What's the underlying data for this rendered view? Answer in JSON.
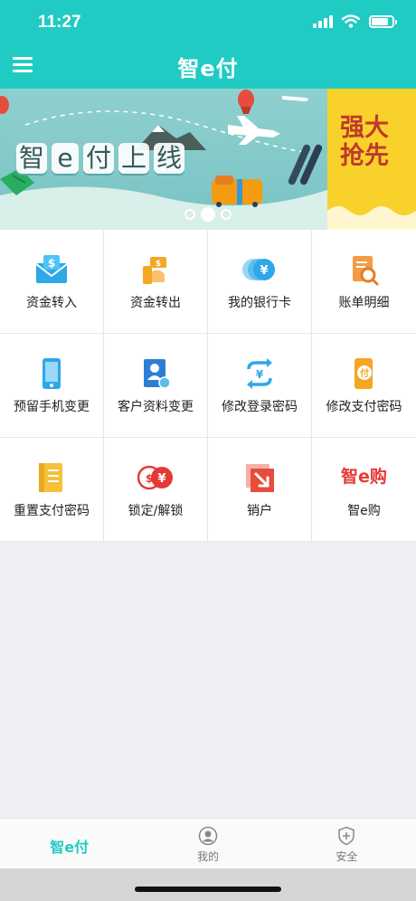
{
  "status": {
    "time": "11:27",
    "battery_level": 0.8
  },
  "header": {
    "title": "智e付",
    "menu_icon": "hamburger-menu-icon"
  },
  "banner": {
    "headline": [
      "智",
      "e",
      "付",
      "上",
      "线"
    ],
    "next_slide_text": [
      "强大",
      "抢先"
    ],
    "page_count": 3,
    "active_page": 2
  },
  "grid": [
    {
      "name": "deposit-funds",
      "label": "资金转入",
      "icon": "money-envelope-icon"
    },
    {
      "name": "withdraw-funds",
      "label": "资金转出",
      "icon": "cash-out-icon"
    },
    {
      "name": "my-bank-cards",
      "label": "我的银行卡",
      "icon": "yuan-coins-icon"
    },
    {
      "name": "bill-details",
      "label": "账单明细",
      "icon": "bill-search-icon"
    },
    {
      "name": "change-phone",
      "label": "预留手机变更",
      "icon": "phone-icon"
    },
    {
      "name": "change-profile",
      "label": "客户资料变更",
      "icon": "profile-document-icon"
    },
    {
      "name": "change-login-password",
      "label": "修改登录密码",
      "icon": "exchange-arrows-icon"
    },
    {
      "name": "change-payment-password",
      "label": "修改支付密码",
      "icon": "payment-phone-icon"
    },
    {
      "name": "reset-payment-password",
      "label": "重置支付密码",
      "icon": "reset-card-icon"
    },
    {
      "name": "lock-unlock",
      "label": "锁定/解锁",
      "icon": "currency-coins-icon"
    },
    {
      "name": "close-account",
      "label": "销户",
      "icon": "close-account-icon"
    },
    {
      "name": "zhi-e-gou",
      "label": "智e购",
      "icon": "zhi-e-gou-logo-icon",
      "logo_text": "智e购"
    }
  ],
  "tabbar": {
    "tabs": [
      {
        "label": "智e付",
        "icon": "zhi-e-fu-logo-icon",
        "active": true
      },
      {
        "label": "我的",
        "icon": "person-icon",
        "active": false
      },
      {
        "label": "安全",
        "icon": "shield-icon",
        "active": false
      }
    ]
  },
  "colors": {
    "brand": "#20cbc3",
    "red": "#e53935",
    "orange": "#f5a623",
    "blue": "#2ea8e8"
  }
}
